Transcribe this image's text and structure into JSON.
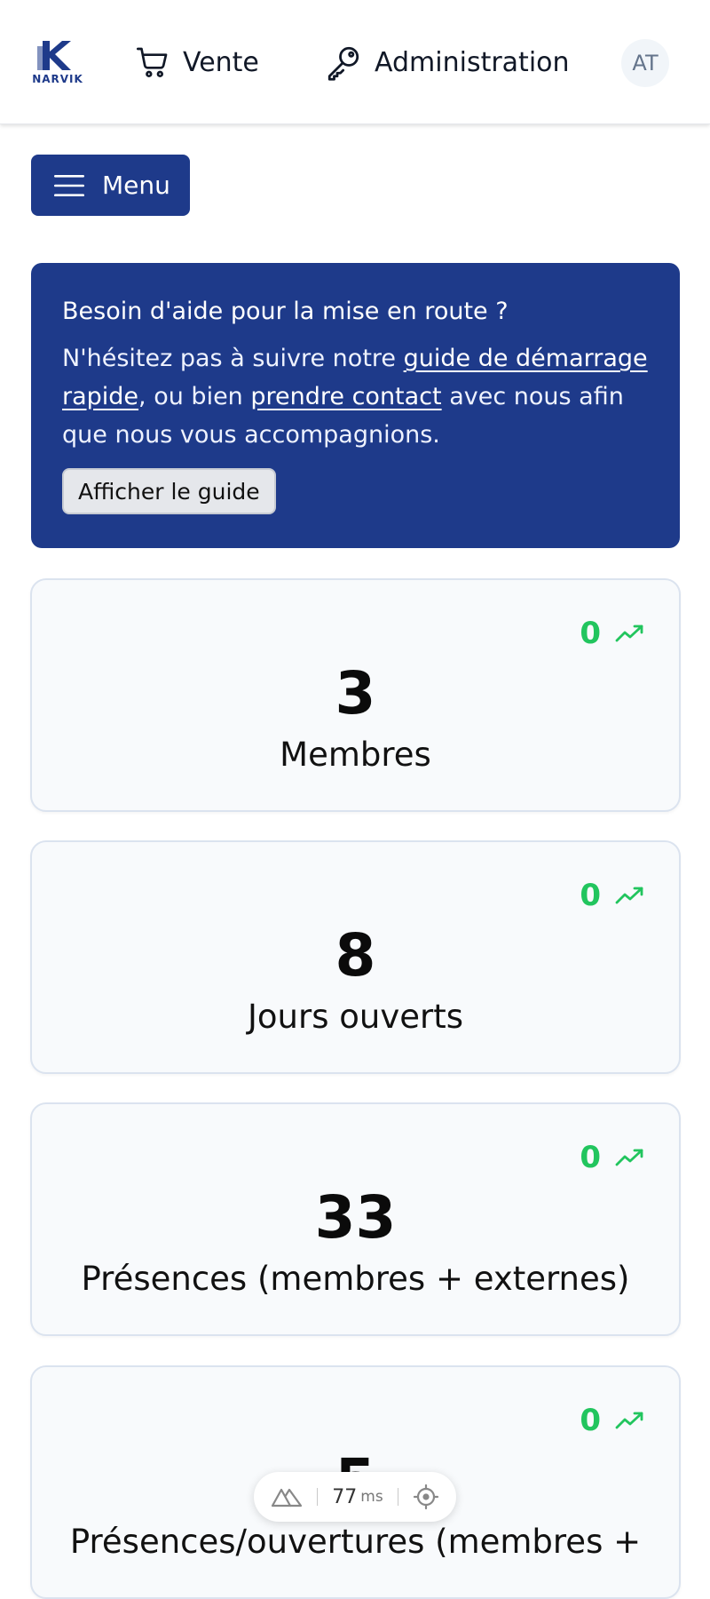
{
  "header": {
    "logo_text": "NARVIK",
    "nav": [
      {
        "label": "Vente",
        "icon": "cart-icon"
      },
      {
        "label": "Administration",
        "icon": "key-icon"
      }
    ],
    "avatar_initials": "AT"
  },
  "menu_button": {
    "label": "Menu",
    "icon": "hamburger-icon"
  },
  "help_banner": {
    "title": "Besoin d'aide pour la mise en route ?",
    "text_before": "N'hésitez pas à suivre notre ",
    "link_guide": "guide de démarrage rapide",
    "text_middle": ", ou bien ",
    "link_contact": "prendre contact",
    "text_after": " avec nous afin que nous vous accompagnions.",
    "button_label": "Afficher le guide"
  },
  "stats": [
    {
      "trend": "0",
      "value": "3",
      "label": "Membres"
    },
    {
      "trend": "0",
      "value": "8",
      "label": "Jours ouverts"
    },
    {
      "trend": "0",
      "value": "33",
      "label": "Présences (membres + externes)"
    },
    {
      "trend": "0",
      "value": "5",
      "label": "Présences/ouvertures (membres +"
    }
  ],
  "perf_widget": {
    "value": "77",
    "unit": "ms",
    "icons": [
      "nuxt-icon",
      "crosshair-icon"
    ]
  },
  "colors": {
    "primary": "#1e3a8a",
    "trend_up": "#22c55e",
    "card_bg": "#f8fafc",
    "card_border": "#dbe3ef"
  }
}
